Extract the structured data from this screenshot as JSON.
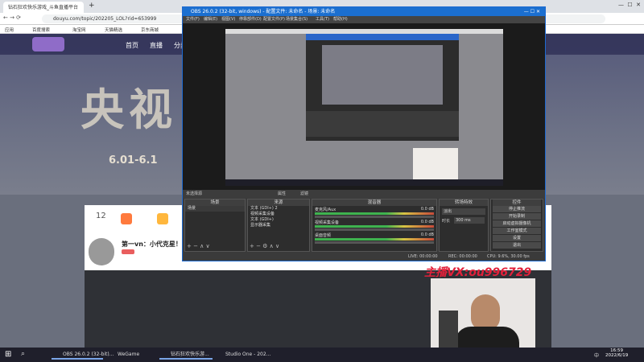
{
  "browser": {
    "tab_title": "钻石狂欢快乐游戏_斗鱼直播平台",
    "new_tab": "+",
    "url": "douyu.com/topic/202205_LOL?rid=653999",
    "bookmarks": [
      "应用",
      "百度搜索",
      "淘宝网",
      "天猫精选",
      "京东商城"
    ]
  },
  "site": {
    "nav": [
      "首页",
      "直播",
      "分类"
    ],
    "banner_text": "央视 钻粉",
    "banner_date": "6.01-6.1",
    "count": "12",
    "streamer_title": "第一vn：小代克星！！",
    "badge": "2"
  },
  "obs": {
    "title": "OBS 26.0.2 (32-bit, windows) - 配置文件: 未命名 - 场景: 未命名",
    "menu": [
      "文件(F)",
      "编辑(E)",
      "视图(V)",
      "停靠部件(D)",
      "配置文件(P)",
      "场景集合(S)",
      "工具(T)",
      "帮助(H)"
    ],
    "scene_label": "未选择源",
    "properties": "属性",
    "filters": "滤镜",
    "docks": {
      "scenes": {
        "title": "场景",
        "items": [
          "场景"
        ]
      },
      "sources": {
        "title": "来源",
        "items": [
          "文本 (GDI+) 2",
          "视频采集设备",
          "文本 (GDI+)",
          "显示器采集"
        ]
      },
      "mixer": {
        "title": "混音器",
        "channels": [
          {
            "name": "麦克风/Aux",
            "db": "0.0 dB"
          },
          {
            "name": "视频采集设备",
            "db": "0.0 dB"
          },
          {
            "name": "桌面音频",
            "db": "0.0 dB"
          }
        ]
      },
      "transitions": {
        "title": "转场特效",
        "type": "淡出",
        "duration_label": "时长",
        "duration": "300 ms"
      },
      "controls": {
        "title": "控件",
        "buttons": [
          "停止推流",
          "开始录制",
          "启动虚拟摄像机",
          "工作室模式",
          "设置",
          "退出"
        ]
      }
    },
    "status": [
      "LIVE: 00:00:00",
      "REC: 00:00:00",
      "CPU: 9.6%, 30.00 fps"
    ]
  },
  "webcam_caption": "主播VX:ou996729",
  "taskbar": {
    "items": [
      "OBS 26.0.2 (32-bit)...",
      "WeGame",
      "钻石狂欢快乐游...",
      "Studio One - 202..."
    ],
    "time": "16:59",
    "date": "2022/6/19",
    "lang": "中"
  }
}
